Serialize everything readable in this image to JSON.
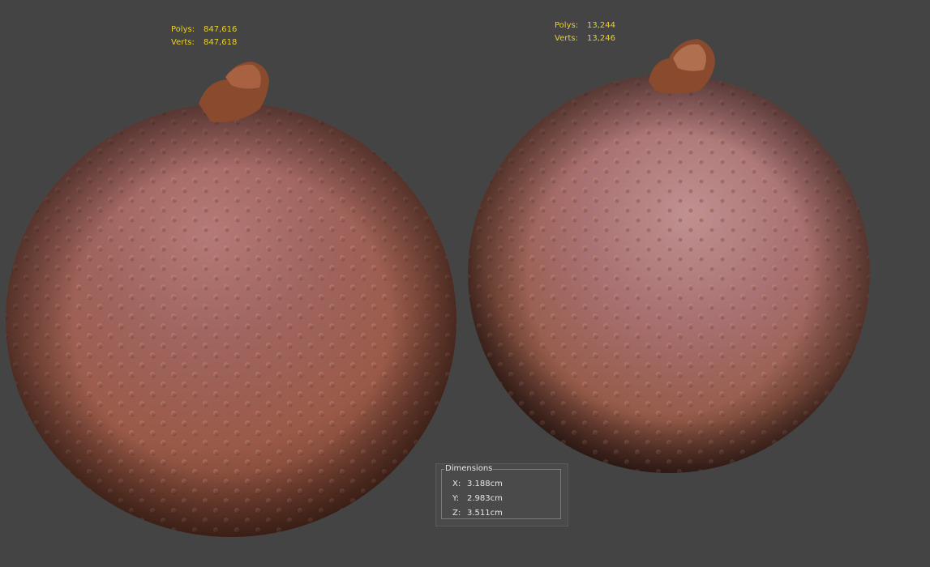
{
  "left_model": {
    "polys_label": "Polys:",
    "polys_value": "847,616",
    "verts_label": "Verts:",
    "verts_value": "847,618"
  },
  "right_model": {
    "polys_label": "Polys:",
    "polys_value": "13,244",
    "verts_label": "Verts:",
    "verts_value": "13,246"
  },
  "dimensions": {
    "title": "Dimensions",
    "rows": [
      {
        "axis": "X:",
        "value": "3.188cm"
      },
      {
        "axis": "Y:",
        "value": "2.983cm"
      },
      {
        "axis": "Z:",
        "value": "3.511cm"
      }
    ]
  },
  "colors": {
    "background": "#444444",
    "stats_text": "#e8cf2a",
    "panel_text": "#e6e6e6"
  }
}
